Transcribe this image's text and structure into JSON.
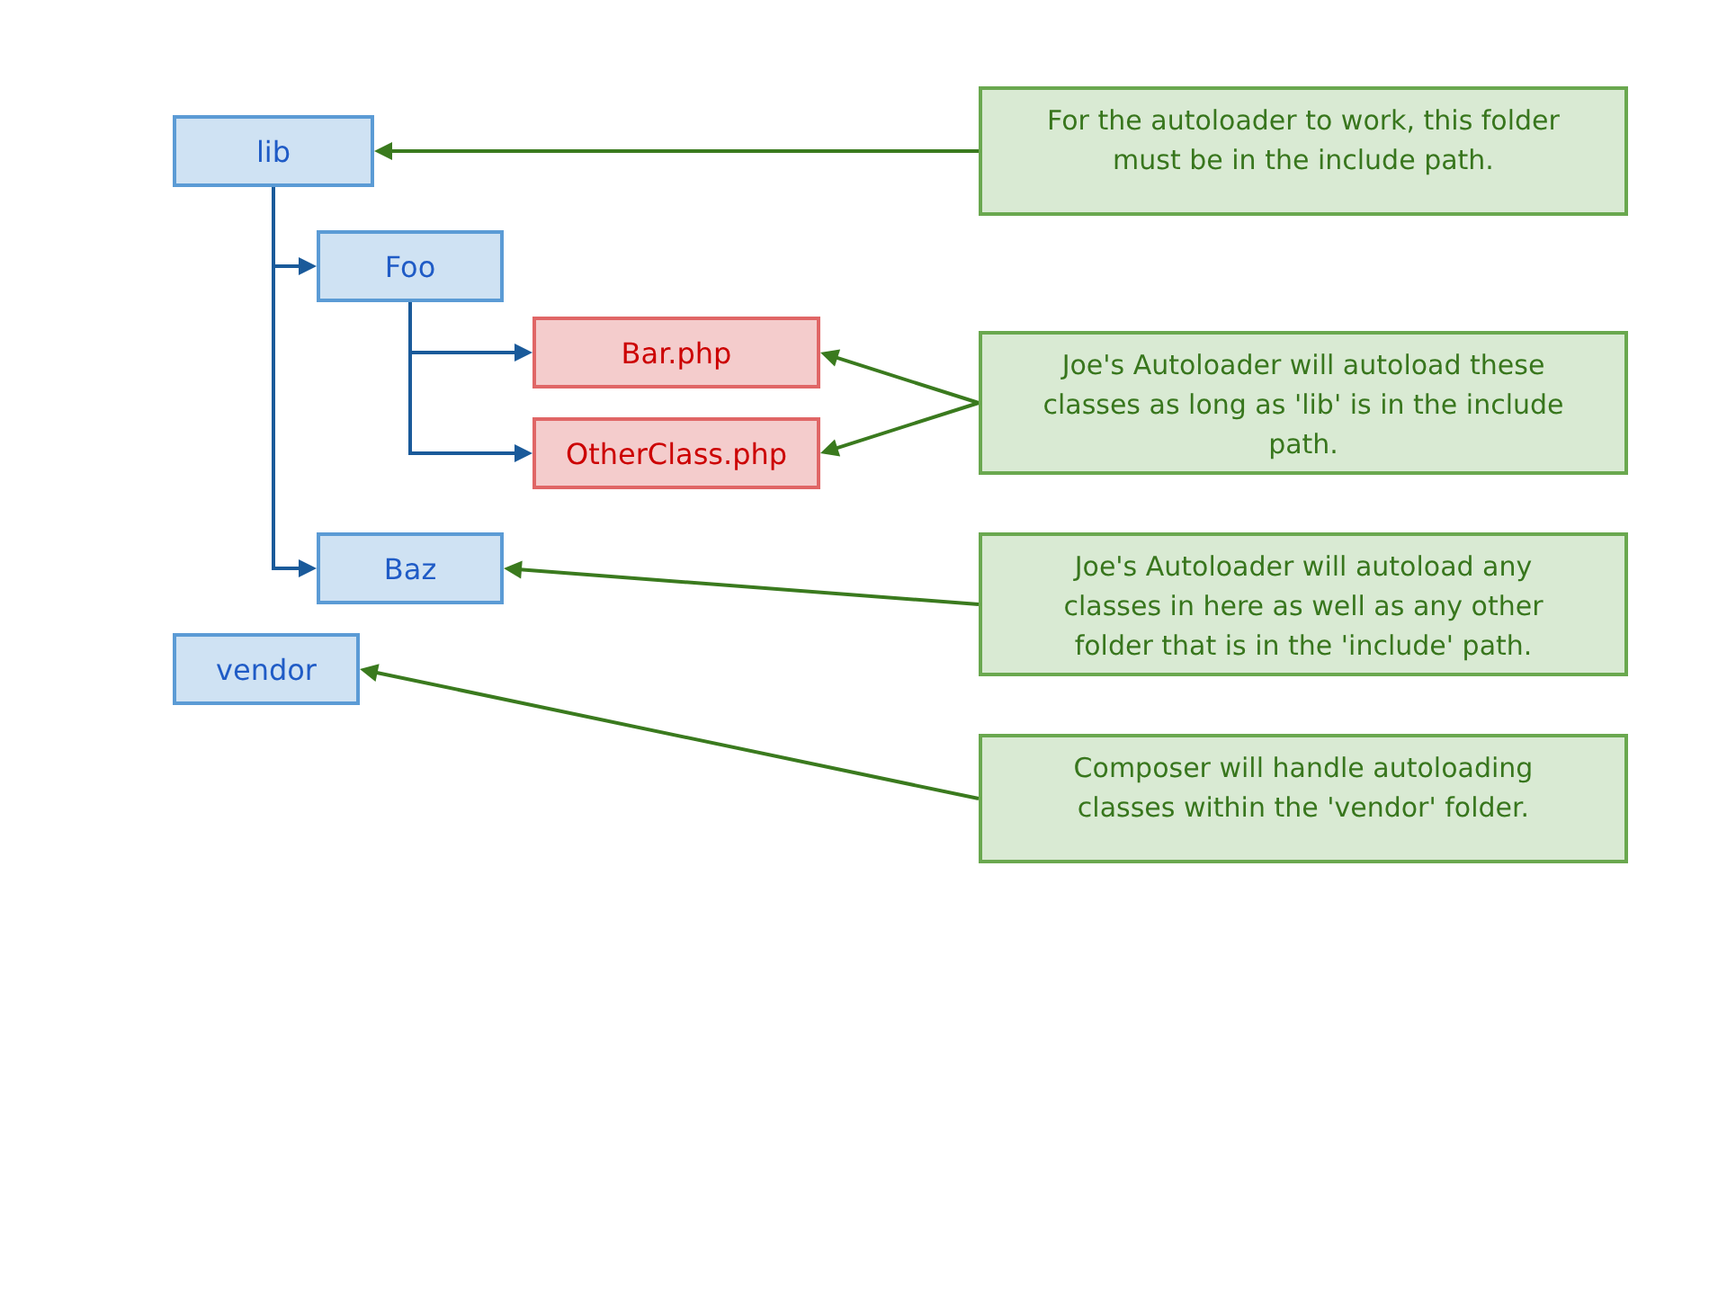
{
  "tree": [
    {
      "label": "lib",
      "kind": "folder",
      "children": [
        {
          "label": "Foo",
          "kind": "folder",
          "children": [
            {
              "label": "Bar.php",
              "kind": "file"
            },
            {
              "label": "OtherClass.php",
              "kind": "file"
            }
          ]
        },
        {
          "label": "Baz",
          "kind": "folder"
        }
      ]
    },
    {
      "label": "vendor",
      "kind": "folder"
    }
  ],
  "notes": [
    {
      "text": "For the autoloader to work, this folder must be in the include path."
    },
    {
      "text": "Joe's Autoloader will autoload these classes as long as 'lib' is in the include path."
    },
    {
      "text": "Joe's Autoloader will autoload any classes in here as well as any other folder that is in the 'include' path."
    },
    {
      "text": "Composer will handle autoloading classes within the 'vendor' folder."
    }
  ]
}
